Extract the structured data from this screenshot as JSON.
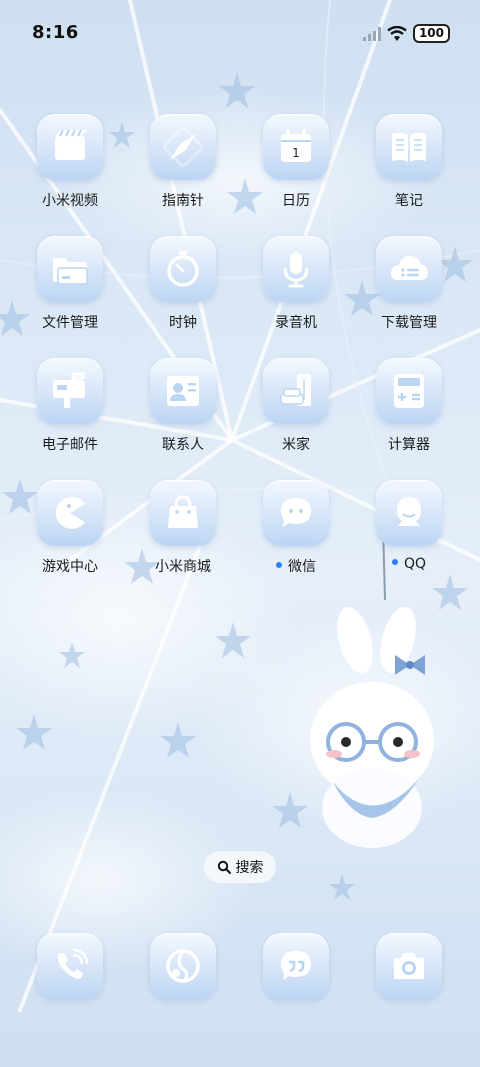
{
  "status_bar": {
    "time": "8:16",
    "battery": "100",
    "icons": [
      "signal-icon",
      "wifi-icon",
      "battery-icon"
    ]
  },
  "apps": [
    {
      "label": "小米视频",
      "icon": "video-icon"
    },
    {
      "label": "指南针",
      "icon": "compass-icon"
    },
    {
      "label": "日历",
      "icon": "calendar-icon",
      "badge_text": "1"
    },
    {
      "label": "笔记",
      "icon": "notes-icon"
    },
    {
      "label": "文件管理",
      "icon": "folder-icon"
    },
    {
      "label": "时钟",
      "icon": "clock-icon"
    },
    {
      "label": "录音机",
      "icon": "microphone-icon"
    },
    {
      "label": "下载管理",
      "icon": "download-icon"
    },
    {
      "label": "电子邮件",
      "icon": "mailbox-icon"
    },
    {
      "label": "联系人",
      "icon": "contacts-icon"
    },
    {
      "label": "米家",
      "icon": "home-icon"
    },
    {
      "label": "计算器",
      "icon": "calculator-icon"
    },
    {
      "label": "游戏中心",
      "icon": "game-icon"
    },
    {
      "label": "小米商城",
      "icon": "shopping-bag-icon"
    },
    {
      "label": "微信",
      "icon": "chat-bubble-icon",
      "new_dot": true
    },
    {
      "label": "QQ",
      "icon": "qq-icon",
      "new_dot": true
    }
  ],
  "search": {
    "label": "搜索",
    "icon": "search-icon"
  },
  "dock": [
    {
      "icon": "phone-icon"
    },
    {
      "icon": "browser-icon"
    },
    {
      "icon": "messages-icon"
    },
    {
      "icon": "camera-icon"
    }
  ],
  "colors": {
    "tile_top": "#f4f8fe",
    "tile_bottom": "#bcd5f3",
    "icon_white": "#ffffff",
    "dot_blue": "#2d7ff9"
  }
}
